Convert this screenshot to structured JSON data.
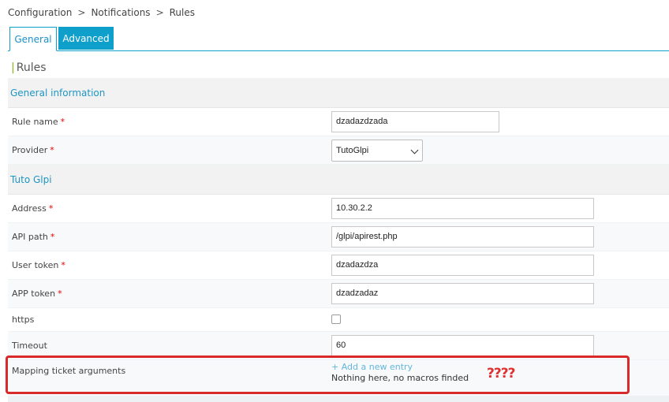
{
  "breadcrumb": {
    "items": [
      "Configuration",
      "Notifications",
      "Rules"
    ],
    "separator": ">"
  },
  "tabs": {
    "general": "General",
    "advanced": "Advanced"
  },
  "page_title": "Rules",
  "sections": {
    "general_information": "General information",
    "tuto_glpi": "Tuto Glpi"
  },
  "fields": {
    "rule_name": {
      "label": "Rule name",
      "required": "*",
      "value": "dzadazdzada"
    },
    "provider": {
      "label": "Provider",
      "required": "*",
      "value": "TutoGlpi"
    },
    "address": {
      "label": "Address",
      "required": "*",
      "value": "10.30.2.2"
    },
    "api_path": {
      "label": "API path",
      "required": "*",
      "value": "/glpi/apirest.php"
    },
    "user_token": {
      "label": "User token",
      "required": "*",
      "value": "dzadazdza"
    },
    "app_token": {
      "label": "APP token",
      "required": "*",
      "value": "dzadzadaz"
    },
    "https": {
      "label": "https",
      "checked": false
    },
    "timeout": {
      "label": "Timeout",
      "value": "60"
    }
  },
  "mapping": {
    "label": "Mapping ticket arguments",
    "add_link": "+ Add a new entry",
    "empty_text": "Nothing here, no macros finded",
    "annotation": "????"
  },
  "colors": {
    "accent": "#0f9fcb",
    "required": "#e00000",
    "highlight": "#d82a2a",
    "title_bar": "#88b917"
  }
}
